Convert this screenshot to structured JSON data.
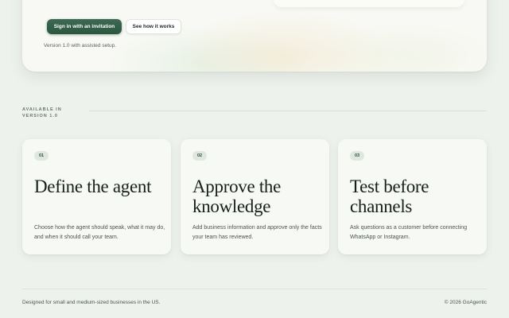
{
  "hero": {
    "primary_cta": "Sign in with an invitation",
    "secondary_cta": "See how it works",
    "version_note": "Version 1.0 with assisted setup."
  },
  "availability": {
    "line1": "AVAILABLE IN",
    "line2": "VERSION 1.0"
  },
  "features": [
    {
      "number": "01",
      "title": "Define the agent",
      "description": "Choose how the agent should speak, what it may do, and when it should call your team."
    },
    {
      "number": "02",
      "title": "Approve the knowledge",
      "description": "Add business information and approve only the facts your team has reviewed."
    },
    {
      "number": "03",
      "title": "Test before channels",
      "description": "Ask questions as a customer before connecting WhatsApp or Instagram."
    }
  ],
  "footer": {
    "tagline": "Designed for small and medium-sized businesses in the US.",
    "copyright": "© 2026 GoAgentic"
  },
  "colors": {
    "page_background": "#eef2ec",
    "primary_button": "#2f5a45",
    "badge_background": "#dfe8de",
    "card_background": "#f7f9f4"
  }
}
